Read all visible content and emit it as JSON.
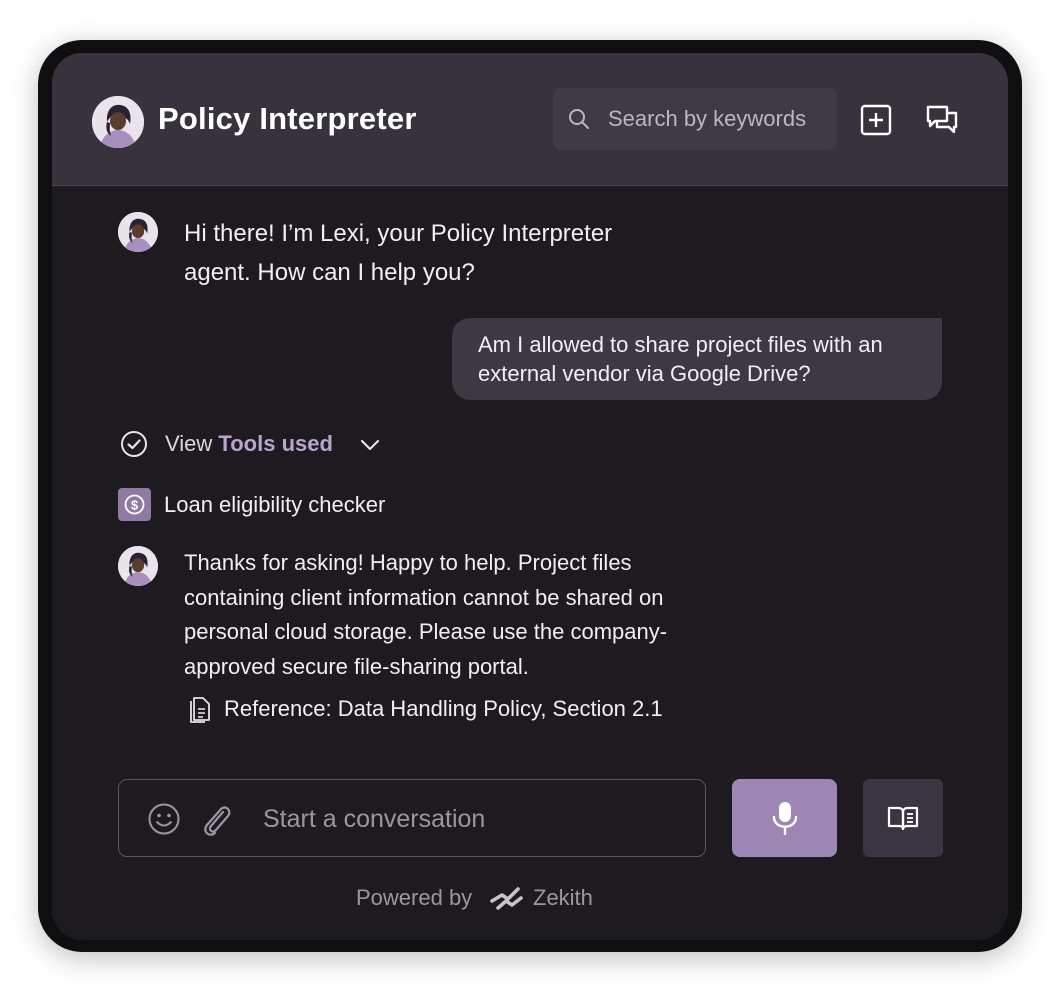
{
  "header": {
    "title": "Policy Interpreter",
    "search_placeholder": "Search by keywords",
    "icons": [
      "avatar",
      "search-icon",
      "new-chat-icon",
      "chat-history-icon"
    ]
  },
  "messages": {
    "greeting": "Hi there! I’m Lexi, your Policy Interpreter agent. How can I help you?",
    "user_question": "Am I allowed to share project files with an external vendor via Google Drive?",
    "tools_prefix": "View",
    "tools_label": "Tools used",
    "tool_name": "Loan eligibility checker",
    "answer": "Thanks for asking! Happy to help. Project files containing client information cannot be shared on personal cloud storage. Please use the company-approved secure file-sharing portal.",
    "reference": "Reference: Data Handling Policy, Section 2.1"
  },
  "composer": {
    "placeholder": "Start a conversation",
    "value": ""
  },
  "footer": {
    "powered_by": "Powered by",
    "brand": "Zekith"
  },
  "colors": {
    "frame": "#0f0e10",
    "background": "#1d1b1f",
    "header": "#37323c",
    "accent": "#9d86b4",
    "tools_accent": "#b9a4cf"
  }
}
